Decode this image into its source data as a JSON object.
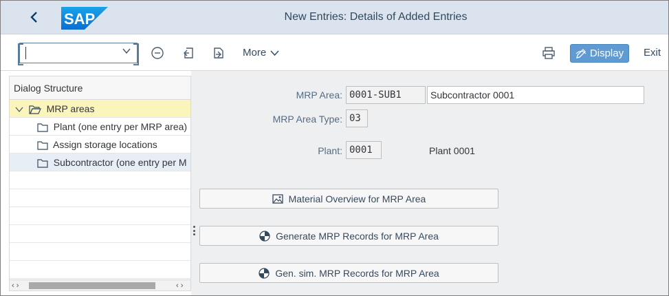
{
  "header": {
    "title": "New Entries: Details of Added Entries",
    "logo_text": "SAP",
    "brand_color": "#0a6ed1"
  },
  "toolbar": {
    "command_value": "",
    "more_label": "More",
    "display_label": "Display",
    "exit_label": "Exit",
    "icons": [
      "chevron-down-icon",
      "minus-circle-icon",
      "previous-entry-icon",
      "next-entry-icon",
      "print-icon",
      "display-icon"
    ]
  },
  "dialog_structure": {
    "title": "Dialog Structure",
    "items": [
      {
        "label": "MRP areas",
        "level": 0,
        "state": "active"
      },
      {
        "label": "Plant (one entry per MRP area)",
        "level": 1,
        "state": ""
      },
      {
        "label": "Assign storage locations",
        "level": 1,
        "state": ""
      },
      {
        "label": "Subcontractor (one entry per M",
        "level": 1,
        "state": "selected"
      }
    ]
  },
  "form": {
    "mrp_area_label": "MRP Area:",
    "mrp_area_value": "0001-SUB1",
    "mrp_area_desc": "Subcontractor 0001",
    "mrp_area_type_label": "MRP Area Type:",
    "mrp_area_type_value": "03",
    "plant_label": "Plant:",
    "plant_value": "0001",
    "plant_desc": "Plant 0001"
  },
  "actions": {
    "material_overview": "Material Overview for MRP Area",
    "generate_records": "Generate MRP Records for MRP Area",
    "gen_sim_records": "Gen. sim. MRP Records for MRP Area"
  }
}
